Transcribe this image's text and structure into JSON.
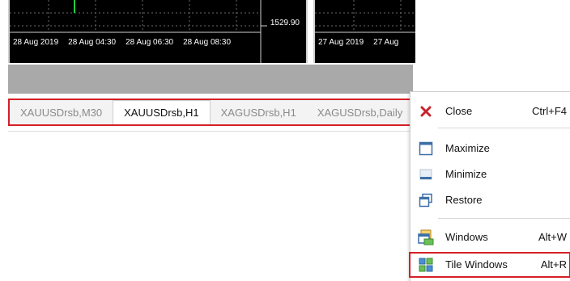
{
  "chart_left": {
    "time_labels": [
      "28 Aug 2019",
      "28 Aug 04:30",
      "28 Aug 06:30",
      "28 Aug 08:30"
    ],
    "price_label": "1529.90"
  },
  "chart_right": {
    "time_labels": [
      "27 Aug 2019",
      "27 Aug"
    ]
  },
  "tabs": [
    {
      "label": "XAUUSDrsb,M30",
      "active": false
    },
    {
      "label": "XAUUSDrsb,H1",
      "active": true
    },
    {
      "label": "XAGUSDrsb,H1",
      "active": false
    },
    {
      "label": "XAGUSDrsb,Daily",
      "active": false
    }
  ],
  "context_menu": {
    "items": [
      {
        "label": "Close",
        "shortcut": "Ctrl+F4",
        "icon": "close-icon"
      },
      {
        "label": "Maximize",
        "shortcut": "",
        "icon": "maximize-icon"
      },
      {
        "label": "Minimize",
        "shortcut": "",
        "icon": "minimize-icon"
      },
      {
        "label": "Restore",
        "shortcut": "",
        "icon": "restore-icon"
      },
      {
        "label": "Windows",
        "shortcut": "Alt+W",
        "icon": "windows-icon"
      },
      {
        "label": "Tile Windows",
        "shortcut": "Alt+R",
        "icon": "tile-windows-icon"
      }
    ]
  },
  "colors": {
    "highlight": "#d61f26",
    "chart_bg": "#000000",
    "band": "#a9a9a9"
  }
}
